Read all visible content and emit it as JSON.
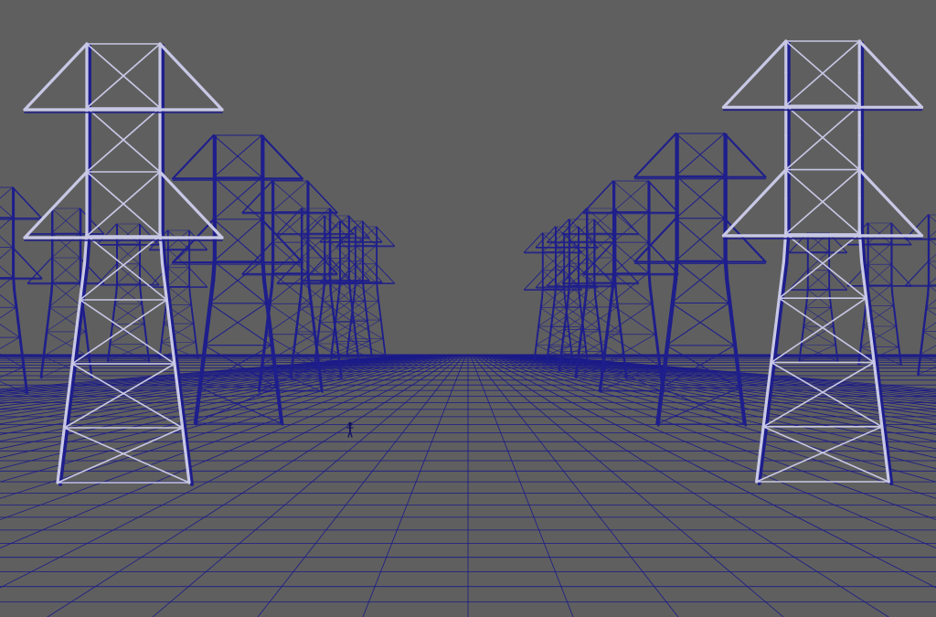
{
  "viewport": {
    "background": "#5f5f5f",
    "wireframe_color": "#1e1e8c",
    "highlight_color": "#c8c8e6",
    "grid_color": "#1a1a88"
  },
  "scene": {
    "objects": [
      {
        "name": "power-pylon",
        "count": 22
      },
      {
        "name": "human-figure",
        "count": 1
      },
      {
        "name": "ground-grid",
        "count": 1
      }
    ]
  }
}
